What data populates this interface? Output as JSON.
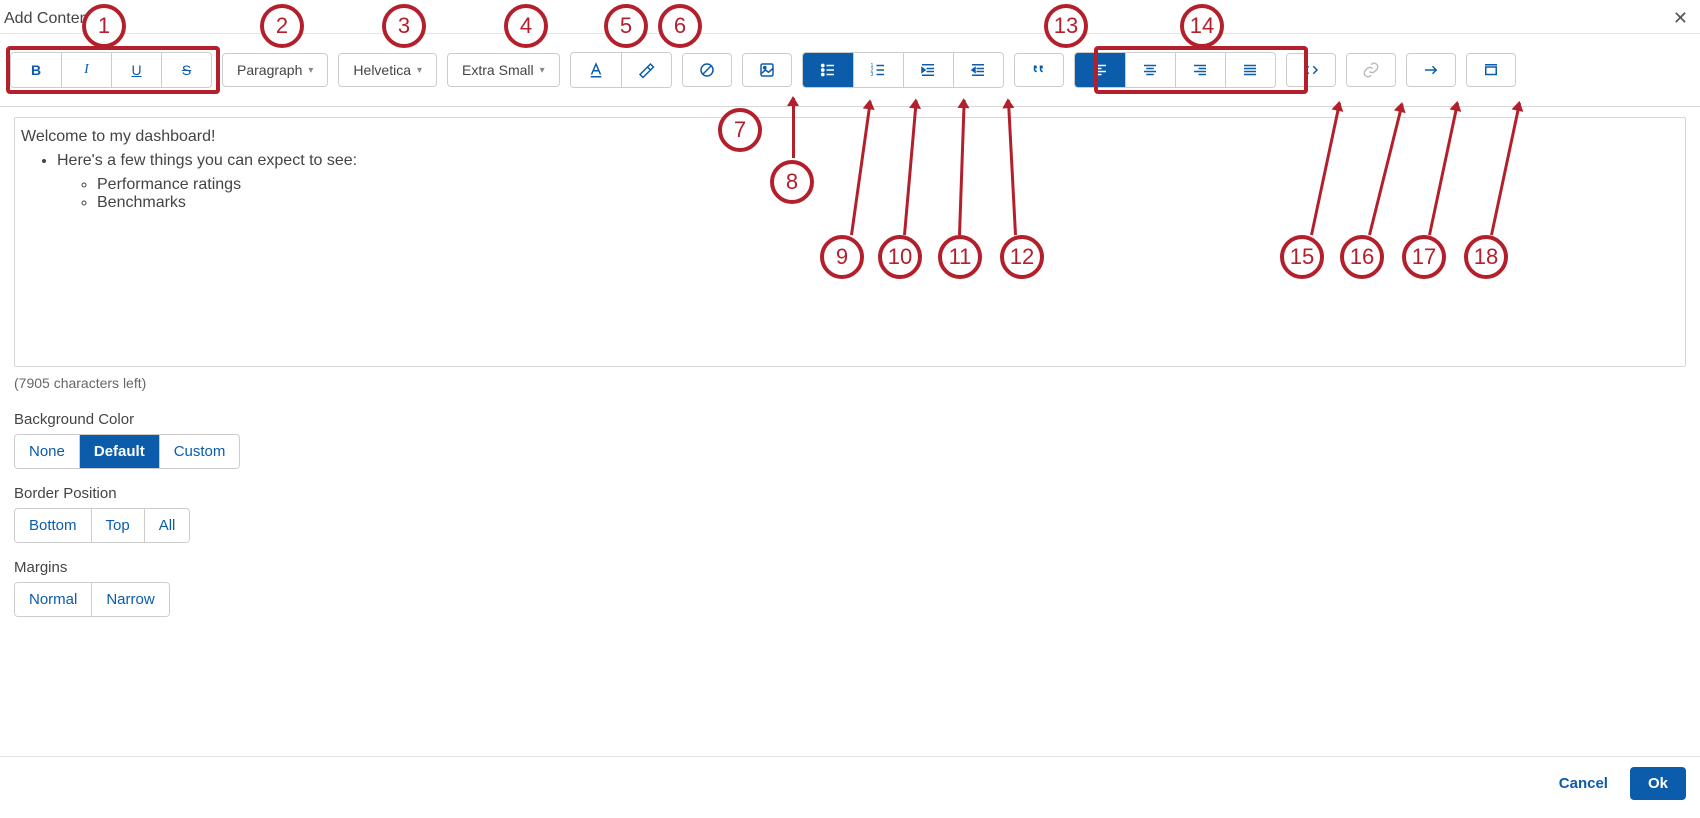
{
  "header": {
    "title": "Add Content"
  },
  "toolbar": {
    "style_dropdown": "Paragraph",
    "font_dropdown": "Helvetica",
    "size_dropdown": "Extra Small"
  },
  "editor": {
    "line1": "Welcome to my dashboard!",
    "line2": "Here's a few things you can expect to see:",
    "bullet1": "Performance ratings",
    "bullet2": "Benchmarks"
  },
  "chars_left_text": "(7905 characters left)",
  "sections": {
    "background_color": {
      "label": "Background Color",
      "options": [
        "None",
        "Default",
        "Custom"
      ],
      "active_index": 1
    },
    "border_position": {
      "label": "Border Position",
      "options": [
        "Bottom",
        "Top",
        "All"
      ],
      "active_index": -1
    },
    "margins": {
      "label": "Margins",
      "options": [
        "Normal",
        "Narrow"
      ],
      "active_index": -1
    }
  },
  "footer": {
    "cancel": "Cancel",
    "ok": "Ok"
  },
  "annotations": {
    "1": "1",
    "2": "2",
    "3": "3",
    "4": "4",
    "5": "5",
    "6": "6",
    "7": "7",
    "8": "8",
    "9": "9",
    "10": "10",
    "11": "11",
    "12": "12",
    "13": "13",
    "14": "14",
    "15": "15",
    "16": "16",
    "17": "17",
    "18": "18"
  }
}
